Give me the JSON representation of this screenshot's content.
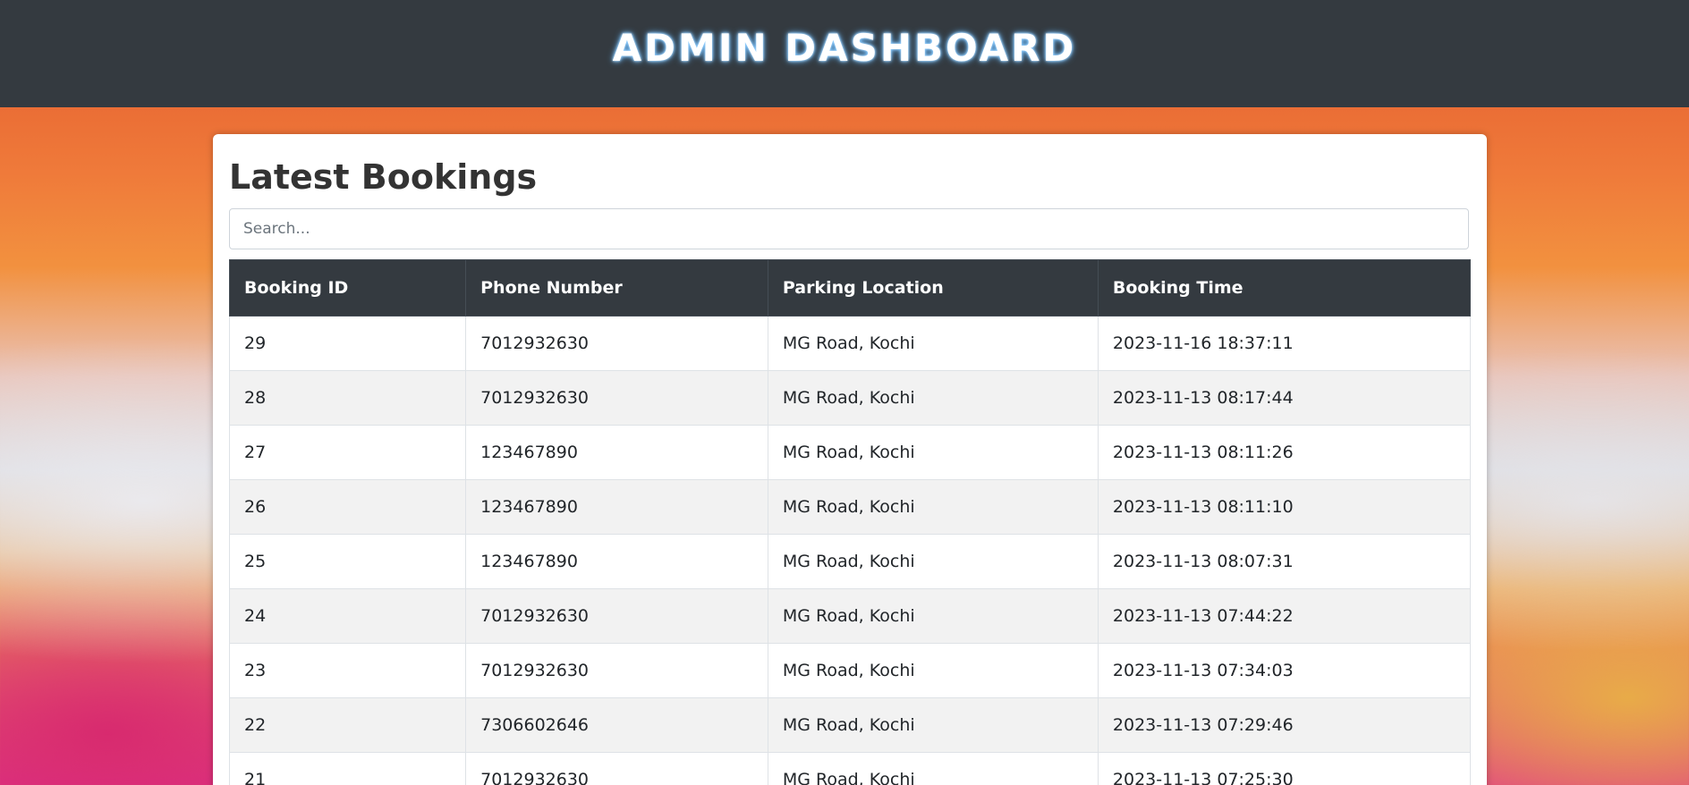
{
  "header": {
    "title": "ADMIN DASHBOARD"
  },
  "main": {
    "heading": "Latest Bookings",
    "search": {
      "placeholder": "Search...",
      "value": ""
    },
    "table": {
      "columns": [
        "Booking ID",
        "Phone Number",
        "Parking Location",
        "Booking Time"
      ],
      "rows": [
        [
          "29",
          "7012932630",
          "MG Road, Kochi",
          "2023-11-16 18:37:11"
        ],
        [
          "28",
          "7012932630",
          "MG Road, Kochi",
          "2023-11-13 08:17:44"
        ],
        [
          "27",
          "123467890",
          "MG Road, Kochi",
          "2023-11-13 08:11:26"
        ],
        [
          "26",
          "123467890",
          "MG Road, Kochi",
          "2023-11-13 08:11:10"
        ],
        [
          "25",
          "123467890",
          "MG Road, Kochi",
          "2023-11-13 08:07:31"
        ],
        [
          "24",
          "7012932630",
          "MG Road, Kochi",
          "2023-11-13 07:44:22"
        ],
        [
          "23",
          "7012932630",
          "MG Road, Kochi",
          "2023-11-13 07:34:03"
        ],
        [
          "22",
          "7306602646",
          "MG Road, Kochi",
          "2023-11-13 07:29:46"
        ],
        [
          "21",
          "7012932630",
          "MG Road, Kochi",
          "2023-11-13 07:25:30"
        ]
      ]
    }
  },
  "colors": {
    "header_bg": "#343a40",
    "table_header_bg": "#343a40",
    "row_stripe": "#f2f2f2",
    "title_glow": "#5fb6ff"
  }
}
